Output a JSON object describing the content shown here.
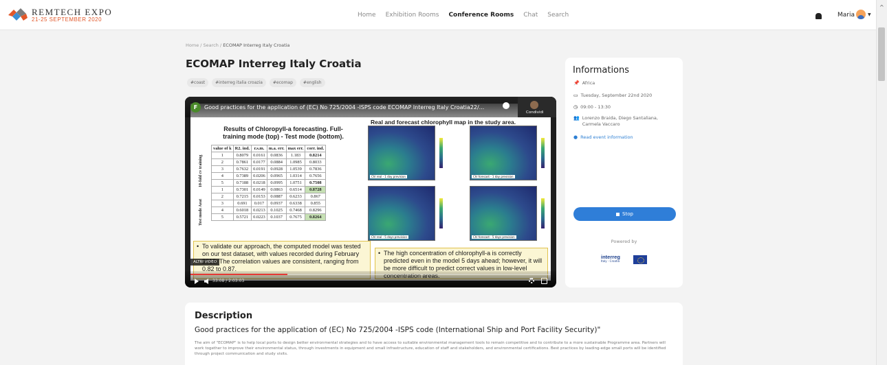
{
  "app": {
    "logo_title": "REMTECH EXPO",
    "logo_subtitle": "21-25 SEPTEMBER 2020"
  },
  "nav": {
    "items": [
      {
        "label": "Home",
        "active": false
      },
      {
        "label": "Exhibition Rooms",
        "active": false
      },
      {
        "label": "Conference Rooms",
        "active": true
      },
      {
        "label": "Chat",
        "active": false
      },
      {
        "label": "Search",
        "active": false
      }
    ],
    "user_name": "Maria"
  },
  "breadcrumb": [
    "Home",
    "Search",
    "ECOMAP Interreg Italy Croatia"
  ],
  "page": {
    "title": "ECOMAP Interreg Italy Croatia",
    "tags": [
      "#coast",
      "#interreg italia croazia",
      "#ecomap",
      "#english"
    ]
  },
  "video": {
    "channel_initial": "F",
    "title": "Good practices for the application of (EC) No 725/2004 -ISPS code ECOMAP Interreg Italy Croatia22/...",
    "share_label": "Condividi",
    "more_videos": "ALTRI VIDEO",
    "time": "33:08 / 2:03:03",
    "progress_fraction": 0.27,
    "slide": {
      "left_title": "Results of Chloropyll-a forecasting. Full-training mode (top) - Test mode (bottom).",
      "right_title": "Real and forecast chlorophyll map in the study area.",
      "table_headers": [
        "value of k",
        "R2. ind.",
        "r.s.m.",
        "m.a. err.",
        "max err.",
        "corr. ind."
      ],
      "group_1": "10-fold cv training",
      "group_2": "Test mode Aeat",
      "rows": [
        [
          "1",
          "0.8079",
          "0.0161",
          "0.0836",
          "1.183",
          "0.8214"
        ],
        [
          "2",
          "0.7861",
          "0.0177",
          "0.0884",
          "1.0985",
          "0.8033"
        ],
        [
          "3",
          "0.7632",
          "0.0191",
          "0.0928",
          "1.0539",
          "0.7836"
        ],
        [
          "4",
          "0.7389",
          "0.0206",
          "0.0965",
          "1.0314",
          "0.7656"
        ],
        [
          "5",
          "0.7188",
          "0.0218",
          "0.0995",
          "1.0751",
          "0.7508"
        ],
        [
          "1",
          "0.7301",
          "0.0149",
          "0.0863",
          "0.6514",
          "0.8728"
        ],
        [
          "2",
          "0.7215",
          "0.0153",
          "0.0887",
          "0.6233",
          "0.867"
        ],
        [
          "3",
          "0.691",
          "0.017",
          "0.0937",
          "0.6338",
          "0.855"
        ],
        [
          "4",
          "0.6018",
          "0.0213",
          "0.1025",
          "0.7468",
          "0.8296"
        ],
        [
          "5",
          "0.5721",
          "0.0223",
          "0.1037",
          "0.7675",
          "0.8264"
        ]
      ],
      "map_labels": [
        "Chl real - 1 day prevision",
        "Chl forecast - 1 day prevision",
        "Chl real - 5 days prevision",
        "Chl forecast - 5 days prevision"
      ],
      "note_left": "To validate our approach, the computed model was tested on our test dataset, with values recorded during February 2018. The correlation values are consistent, ranging from 0.82 to 0.87.",
      "note_right": "The high concentration of chlorophyll-a is correctly predicted even in the model 5 days ahead; however, it will be more difficult to predict correct values in low-level concentration areas."
    }
  },
  "info": {
    "title": "Informations",
    "location": "Africa",
    "date": "Tuesday, September 22nd 2020",
    "time": "09:00 - 13:30",
    "speakers": "Lorenzo Braida, Diego Santaliana, Carmela Vaccaro",
    "read_more": "Read event information",
    "stop_label": "Stop",
    "powered_by": "Powered by",
    "sponsor_name": "interreg",
    "sponsor_sub": "Italy - Croatia"
  },
  "description": {
    "heading": "Description",
    "subtitle": "Good practices for the application of (EC) No 725/2004 -ISPS code (International Ship and Port Facility Security)\"",
    "body": "The aim of \"ECOMAP\" is to help local ports to design better environmental strategies and to have access to suitable environmental management tools to remain competitive and to contribute to a more sustainable Programme area. Partners will work together to improve their environmental status, through investments in equipment and small infrastructure, education of staff and stakeholders, and environmental certifications. Best practices by leading-edge small ports will be identified through project communication and study visits."
  },
  "colors": {
    "accent": "#2f7ed8",
    "brand_orange": "#e2582a",
    "highlight_green": "#c6e0b4"
  }
}
